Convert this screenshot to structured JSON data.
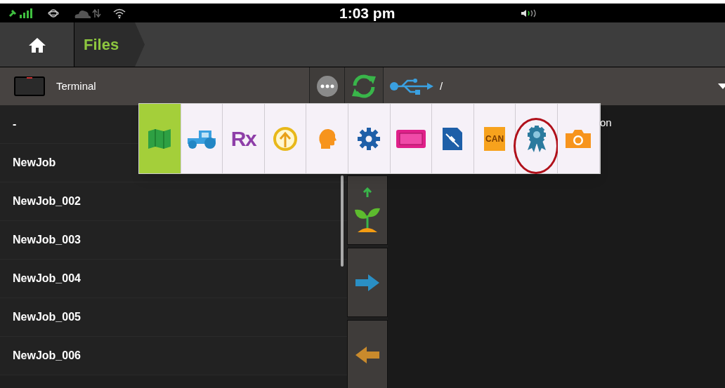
{
  "status_bar": {
    "time": "1:03 pm"
  },
  "nav": {
    "breadcrumb": "Files"
  },
  "toolbar": {
    "source": "Terminal",
    "path": "/"
  },
  "file_list": [
    {
      "name": "-",
      "selected": false
    },
    {
      "name": "NewJob",
      "selected": false
    },
    {
      "name": "NewJob_002",
      "selected": false
    },
    {
      "name": "NewJob_003",
      "selected": false
    },
    {
      "name": "NewJob_004",
      "selected": false
    },
    {
      "name": "NewJob_005",
      "selected": false
    },
    {
      "name": "NewJob_006",
      "selected": false
    }
  ],
  "right_panel": {
    "column_text": "on"
  },
  "side_buttons": [
    {
      "kind": "plant-up"
    },
    {
      "kind": "arrow-right"
    },
    {
      "kind": "arrow-left"
    }
  ],
  "type_menu": [
    {
      "kind": "map",
      "selected": true,
      "circled": false
    },
    {
      "kind": "tractor",
      "selected": false,
      "circled": false
    },
    {
      "kind": "text",
      "label": "Rx",
      "selected": false,
      "circled": false
    },
    {
      "kind": "upload",
      "selected": false,
      "circled": false
    },
    {
      "kind": "person",
      "selected": false,
      "circled": false
    },
    {
      "kind": "gear",
      "selected": false,
      "circled": false
    },
    {
      "kind": "display",
      "selected": false,
      "circled": false
    },
    {
      "kind": "satellite",
      "selected": false,
      "circled": false
    },
    {
      "kind": "file",
      "label": "CAN",
      "selected": false,
      "circled": false
    },
    {
      "kind": "award",
      "selected": false,
      "circled": true
    },
    {
      "kind": "camera",
      "selected": false,
      "circled": false
    }
  ]
}
